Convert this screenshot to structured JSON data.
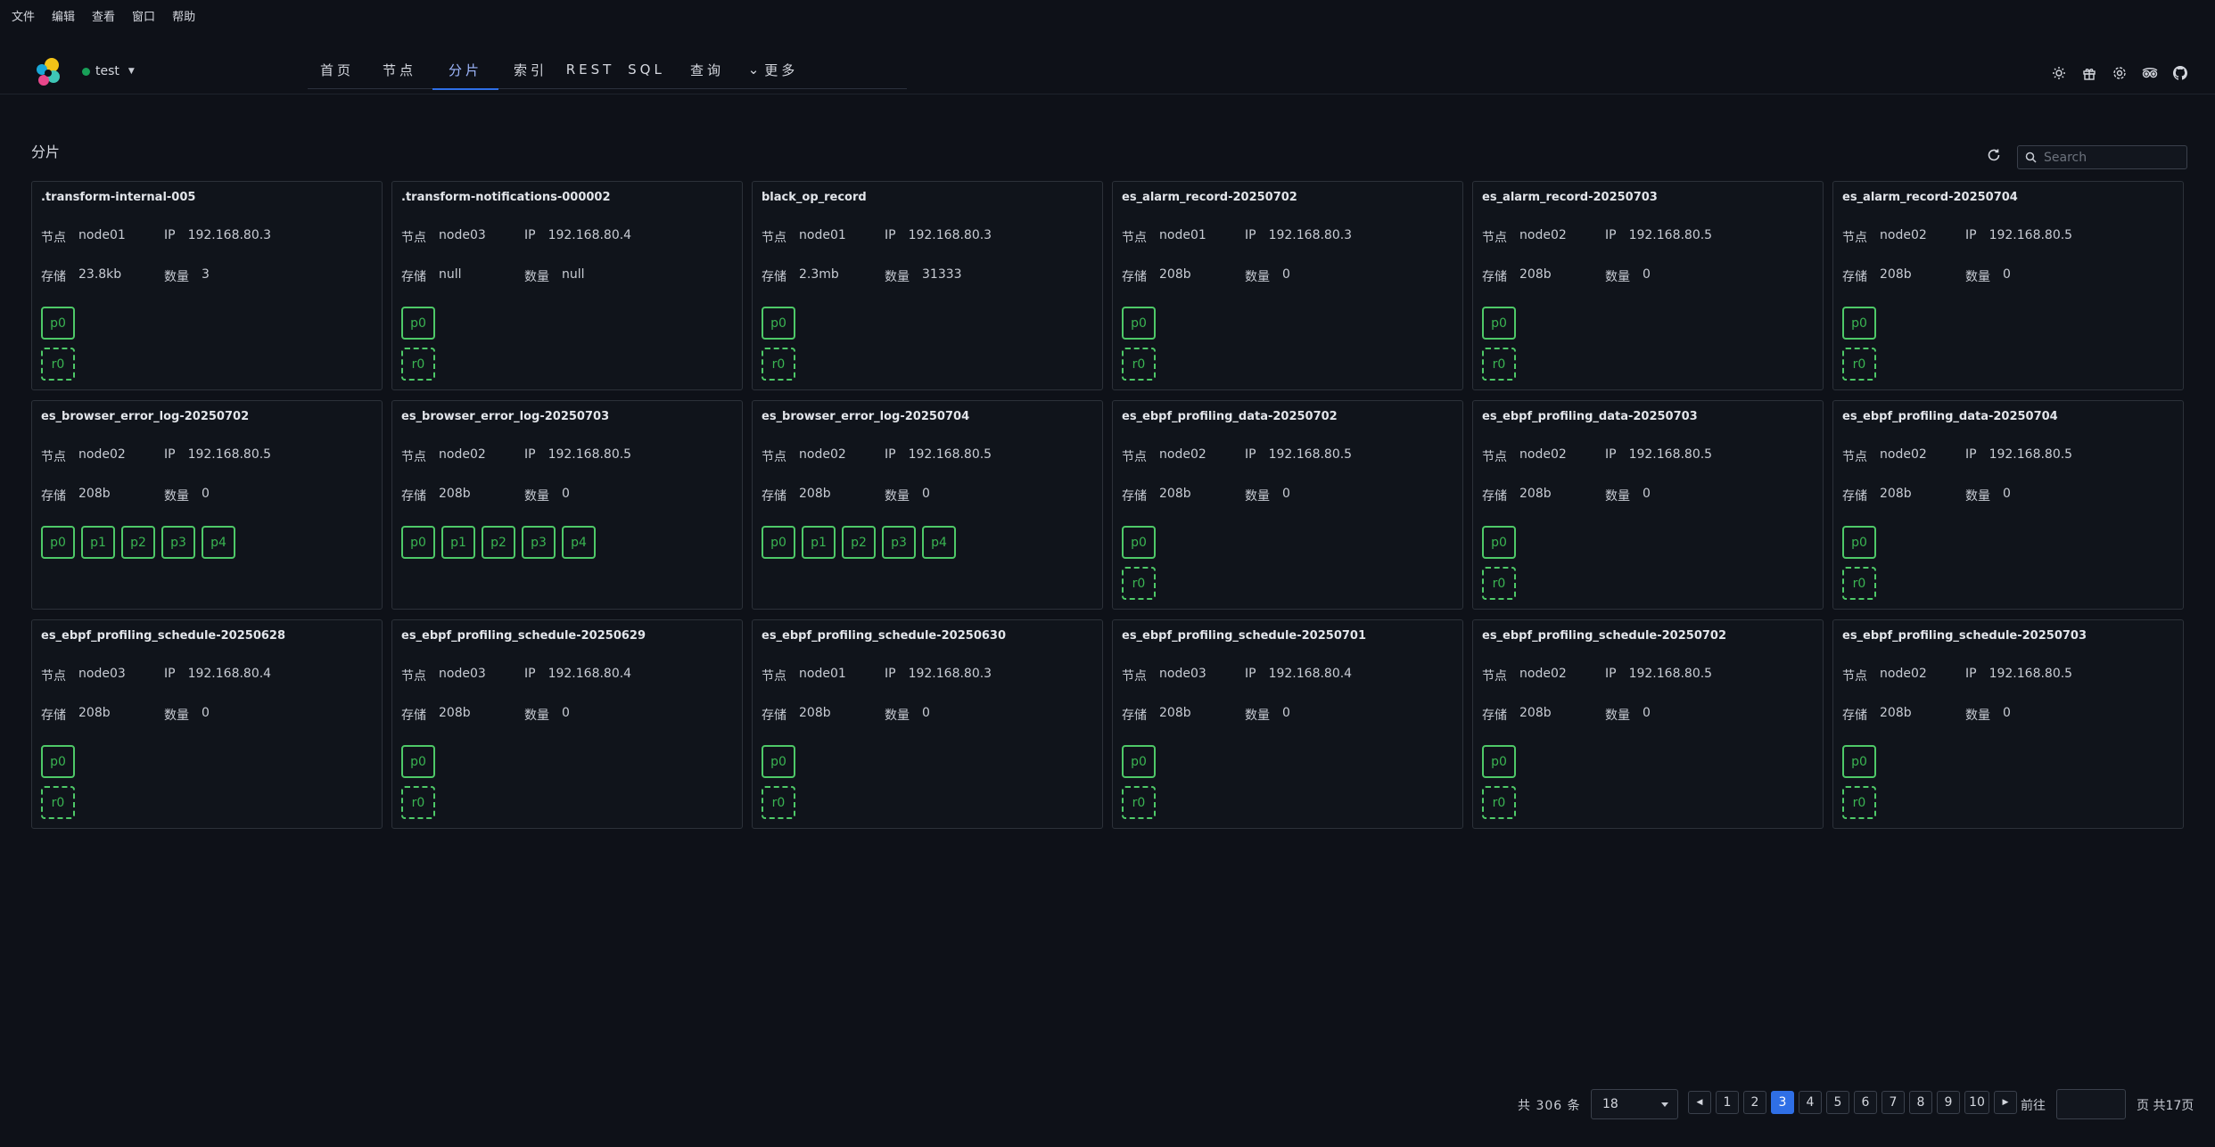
{
  "menu": [
    "文件",
    "编辑",
    "查看",
    "窗口",
    "帮助"
  ],
  "cluster": {
    "name": "test",
    "status_color": "#18a058"
  },
  "nav": {
    "tabs": [
      {
        "label": "首页",
        "active": false,
        "width": 66
      },
      {
        "label": "节点",
        "active": false,
        "width": 74
      },
      {
        "label": "分片",
        "active": true,
        "width": 74
      },
      {
        "label": "索引",
        "active": false,
        "width": 72
      },
      {
        "label": "REST",
        "active": false,
        "width": 62
      },
      {
        "label": "SQL",
        "active": false,
        "width": 64
      },
      {
        "label": "查询",
        "active": false,
        "width": 72
      },
      {
        "label": "更多",
        "active": false,
        "width": 76
      }
    ]
  },
  "header_icons": [
    "sun-icon",
    "gift-icon",
    "gear-icon",
    "tripadvisor-icon",
    "github-icon"
  ],
  "section": {
    "title": "分片"
  },
  "search": {
    "placeholder": "Search"
  },
  "labels": {
    "node": "节点",
    "ip": "IP",
    "storage": "存储",
    "count": "数量"
  },
  "cards": [
    {
      "name": ".transform-internal-005",
      "node": "node01",
      "ip": "192.168.80.3",
      "storage": "23.8kb",
      "count": "3",
      "primaries": [
        "p0"
      ],
      "replica": "r0"
    },
    {
      "name": ".transform-notifications-000002",
      "node": "node03",
      "ip": "192.168.80.4",
      "storage": "null",
      "count": "null",
      "primaries": [
        "p0"
      ],
      "replica": "r0"
    },
    {
      "name": "black_op_record",
      "node": "node01",
      "ip": "192.168.80.3",
      "storage": "2.3mb",
      "count": "31333",
      "primaries": [
        "p0"
      ],
      "replica": "r0"
    },
    {
      "name": "es_alarm_record-20250702",
      "node": "node01",
      "ip": "192.168.80.3",
      "storage": "208b",
      "count": "0",
      "primaries": [
        "p0"
      ],
      "replica": "r0"
    },
    {
      "name": "es_alarm_record-20250703",
      "node": "node02",
      "ip": "192.168.80.5",
      "storage": "208b",
      "count": "0",
      "primaries": [
        "p0"
      ],
      "replica": "r0"
    },
    {
      "name": "es_alarm_record-20250704",
      "node": "node02",
      "ip": "192.168.80.5",
      "storage": "208b",
      "count": "0",
      "primaries": [
        "p0"
      ],
      "replica": "r0"
    },
    {
      "name": "es_browser_error_log-20250702",
      "node": "node02",
      "ip": "192.168.80.5",
      "storage": "208b",
      "count": "0",
      "primaries": [
        "p0",
        "p1",
        "p2",
        "p3",
        "p4"
      ],
      "replica": null
    },
    {
      "name": "es_browser_error_log-20250703",
      "node": "node02",
      "ip": "192.168.80.5",
      "storage": "208b",
      "count": "0",
      "primaries": [
        "p0",
        "p1",
        "p2",
        "p3",
        "p4"
      ],
      "replica": null
    },
    {
      "name": "es_browser_error_log-20250704",
      "node": "node02",
      "ip": "192.168.80.5",
      "storage": "208b",
      "count": "0",
      "primaries": [
        "p0",
        "p1",
        "p2",
        "p3",
        "p4"
      ],
      "replica": null
    },
    {
      "name": "es_ebpf_profiling_data-20250702",
      "node": "node02",
      "ip": "192.168.80.5",
      "storage": "208b",
      "count": "0",
      "primaries": [
        "p0"
      ],
      "replica": "r0"
    },
    {
      "name": "es_ebpf_profiling_data-20250703",
      "node": "node02",
      "ip": "192.168.80.5",
      "storage": "208b",
      "count": "0",
      "primaries": [
        "p0"
      ],
      "replica": "r0"
    },
    {
      "name": "es_ebpf_profiling_data-20250704",
      "node": "node02",
      "ip": "192.168.80.5",
      "storage": "208b",
      "count": "0",
      "primaries": [
        "p0"
      ],
      "replica": "r0"
    },
    {
      "name": "es_ebpf_profiling_schedule-20250628",
      "node": "node03",
      "ip": "192.168.80.4",
      "storage": "208b",
      "count": "0",
      "primaries": [
        "p0"
      ],
      "replica": "r0"
    },
    {
      "name": "es_ebpf_profiling_schedule-20250629",
      "node": "node03",
      "ip": "192.168.80.4",
      "storage": "208b",
      "count": "0",
      "primaries": [
        "p0"
      ],
      "replica": "r0"
    },
    {
      "name": "es_ebpf_profiling_schedule-20250630",
      "node": "node01",
      "ip": "192.168.80.3",
      "storage": "208b",
      "count": "0",
      "primaries": [
        "p0"
      ],
      "replica": "r0"
    },
    {
      "name": "es_ebpf_profiling_schedule-20250701",
      "node": "node03",
      "ip": "192.168.80.4",
      "storage": "208b",
      "count": "0",
      "primaries": [
        "p0"
      ],
      "replica": "r0"
    },
    {
      "name": "es_ebpf_profiling_schedule-20250702",
      "node": "node02",
      "ip": "192.168.80.5",
      "storage": "208b",
      "count": "0",
      "primaries": [
        "p0"
      ],
      "replica": "r0"
    },
    {
      "name": "es_ebpf_profiling_schedule-20250703",
      "node": "node02",
      "ip": "192.168.80.5",
      "storage": "208b",
      "count": "0",
      "primaries": [
        "p0"
      ],
      "replica": "r0"
    }
  ],
  "pagination": {
    "total_text": "共 306 条",
    "page_size": "18",
    "pages": [
      "1",
      "2",
      "3",
      "4",
      "5",
      "6",
      "7",
      "8",
      "9",
      "10"
    ],
    "current": "3",
    "goto_label": "前往",
    "pages_total_text": "页 共17页"
  },
  "colors": {
    "accent": "#2f6fe6",
    "shard_green": "#4ec968",
    "background": "#0e1118"
  }
}
